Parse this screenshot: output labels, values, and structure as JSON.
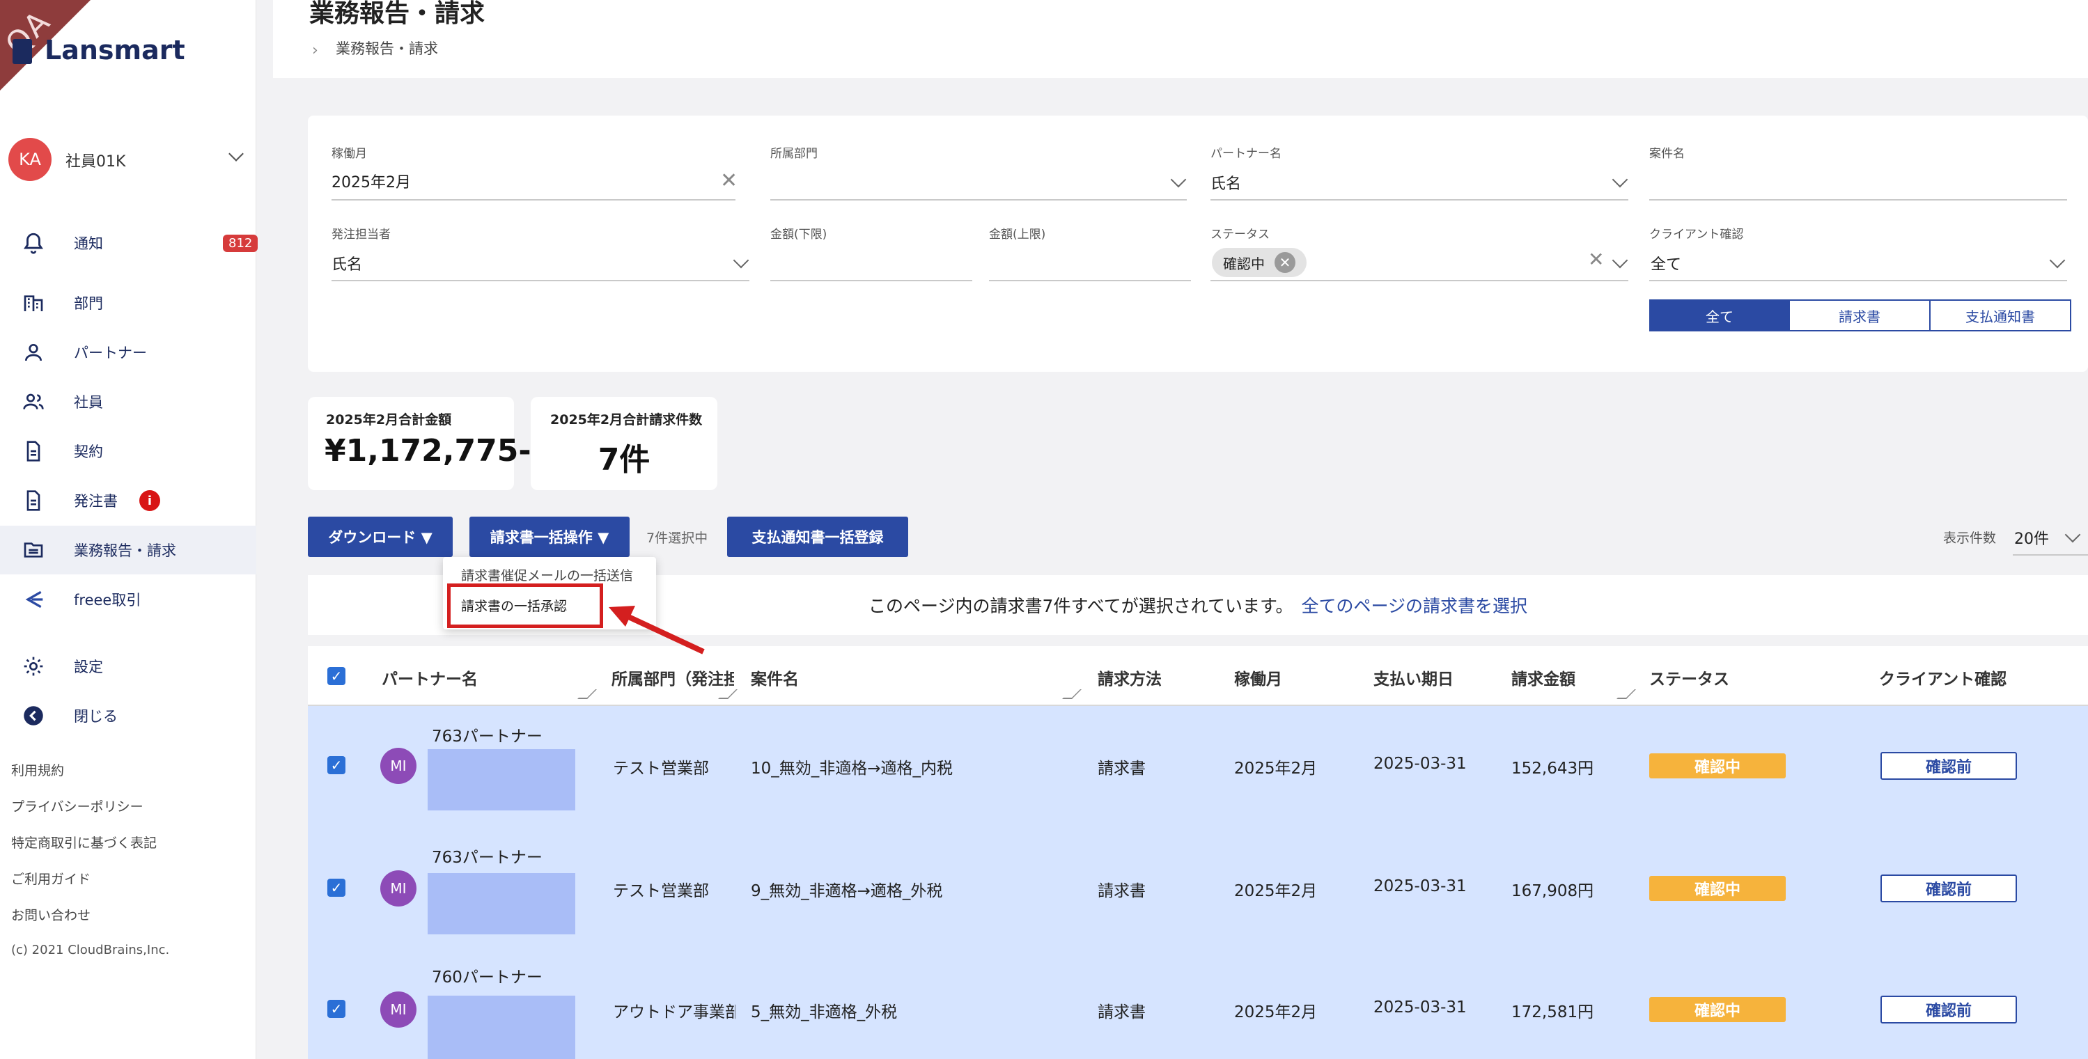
{
  "qa_badge": "QA",
  "app": {
    "logo_text": "Lansmart"
  },
  "user": {
    "initials": "KA",
    "name": "社員01K"
  },
  "nav": {
    "notifications": {
      "label": "通知",
      "badge": "812"
    },
    "items": [
      {
        "label": "部門",
        "icon": "building-icon"
      },
      {
        "label": "パートナー",
        "icon": "person-icon"
      },
      {
        "label": "社員",
        "icon": "people-icon"
      },
      {
        "label": "契約",
        "icon": "document-icon"
      },
      {
        "label": "発注書",
        "icon": "document-icon",
        "alert": "i"
      },
      {
        "label": "業務報告・請求",
        "icon": "folder-icon",
        "active": true
      },
      {
        "label": "freee取引",
        "icon": "freee-icon"
      }
    ],
    "settings": "設定",
    "close": "閉じる"
  },
  "footer_links": [
    "利用規約",
    "プライバシーポリシー",
    "特定商取引に基づく表記",
    "ご利用ガイド",
    "お問い合わせ"
  ],
  "copyright": "(c) 2021 CloudBrains,Inc.",
  "header": {
    "title": "業務報告・請求",
    "breadcrumb": "業務報告・請求"
  },
  "filters": {
    "month": {
      "label": "稼働月",
      "value": "2025年2月"
    },
    "department": {
      "label": "所属部門",
      "value": ""
    },
    "partner": {
      "label": "パートナー名",
      "value": "氏名"
    },
    "project": {
      "label": "案件名",
      "value": ""
    },
    "orderer": {
      "label": "発注担当者",
      "value": "氏名"
    },
    "amount_min": {
      "label": "金額(下限)",
      "value": ""
    },
    "amount_max": {
      "label": "金額(上限)",
      "value": ""
    },
    "status": {
      "label": "ステータス",
      "chip": "確認中"
    },
    "client_confirm": {
      "label": "クライアント確認",
      "value": "全て"
    },
    "doc_type": {
      "options": [
        "全て",
        "請求書",
        "支払通知書"
      ],
      "selected": "全て"
    }
  },
  "summary": {
    "total_amount": {
      "title": "2025年2月合計金額",
      "value": "¥1,172,775-"
    },
    "total_count": {
      "title": "2025年2月合計請求件数",
      "value": "7件"
    }
  },
  "toolbar": {
    "download": "ダウンロード ▼",
    "bulk_invoice": "請求書一括操作 ▼",
    "selected_count": "7件選択中",
    "bulk_register": "支払通知書一括登録",
    "per_page_label": "表示件数",
    "per_page_value": "20件"
  },
  "dropdown": {
    "items": [
      "請求書催促メールの一括送信",
      "請求書の一括承認"
    ],
    "highlight_color": "#d41f1f"
  },
  "banner": {
    "text": "このページ内の請求書7件すべてが選択されています。",
    "link": "全てのページの請求書を選択"
  },
  "table": {
    "headers": [
      "パートナー名",
      "所属部門（発注担",
      "案件名",
      "請求方法",
      "稼働月",
      "支払い期日",
      "請求金額",
      "ステータス",
      "クライアント確認"
    ],
    "rows": [
      {
        "initials": "MI",
        "partner": "763パートナー",
        "department": "テスト営業部",
        "project": "10_無効_非適格→適格_内税",
        "method": "請求書",
        "month": "2025年2月",
        "due": "2025-03-31",
        "amount": "152,643円",
        "status": "確認中",
        "client": "確認前"
      },
      {
        "initials": "MI",
        "partner": "763パートナー",
        "department": "テスト営業部",
        "project": "9_無効_非適格→適格_外税",
        "method": "請求書",
        "month": "2025年2月",
        "due": "2025-03-31",
        "amount": "167,908円",
        "status": "確認中",
        "client": "確認前"
      },
      {
        "initials": "MI",
        "partner": "760パートナー",
        "department": "アウトドア事業部",
        "project": "5_無効_非適格_外税",
        "method": "請求書",
        "month": "2025年2月",
        "due": "2025-03-31",
        "amount": "172,581円",
        "status": "確認中",
        "client": "確認前"
      }
    ]
  },
  "colors": {
    "primary": "#2b4aa3",
    "row_selected": "#d6e4ff",
    "status_pending": "#f6b33c",
    "alert_red": "#d63b3b"
  }
}
